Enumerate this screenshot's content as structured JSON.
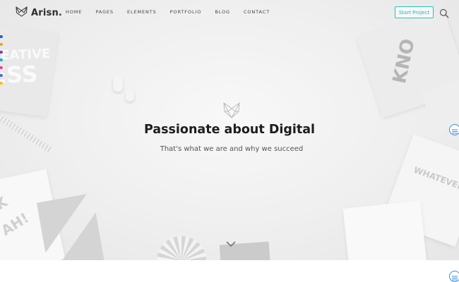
{
  "brand": {
    "name": "Arisn."
  },
  "nav": {
    "items": [
      {
        "label": "HOME"
      },
      {
        "label": "PAGES"
      },
      {
        "label": "ELEMENTS"
      },
      {
        "label": "PORTFOLIO"
      },
      {
        "label": "BLOG"
      },
      {
        "label": "CONTACT"
      }
    ]
  },
  "header": {
    "cta_label": "Start Project",
    "search_icon": "search-icon"
  },
  "hero": {
    "title": "Passionate about Digital",
    "subtitle": "That's what we are and why we succeed",
    "emblem_icon": "fox-logo-icon",
    "scroll_icon": "chevron-down-icon",
    "background_words": [
      "EATIVE",
      "ESS",
      "KNO",
      "WHATEVER",
      "K",
      "AH!"
    ]
  },
  "side": {
    "panel_icon": "menu-list-icon"
  },
  "colors": {
    "accent": "#27c2c2",
    "side_button": "#3a8bd8",
    "swatches": [
      "#2b63c6",
      "#f2a51a",
      "#7b3fc4",
      "#1fb3c9",
      "#e8429b",
      "#4a6fe0",
      "#f4c21e"
    ]
  }
}
